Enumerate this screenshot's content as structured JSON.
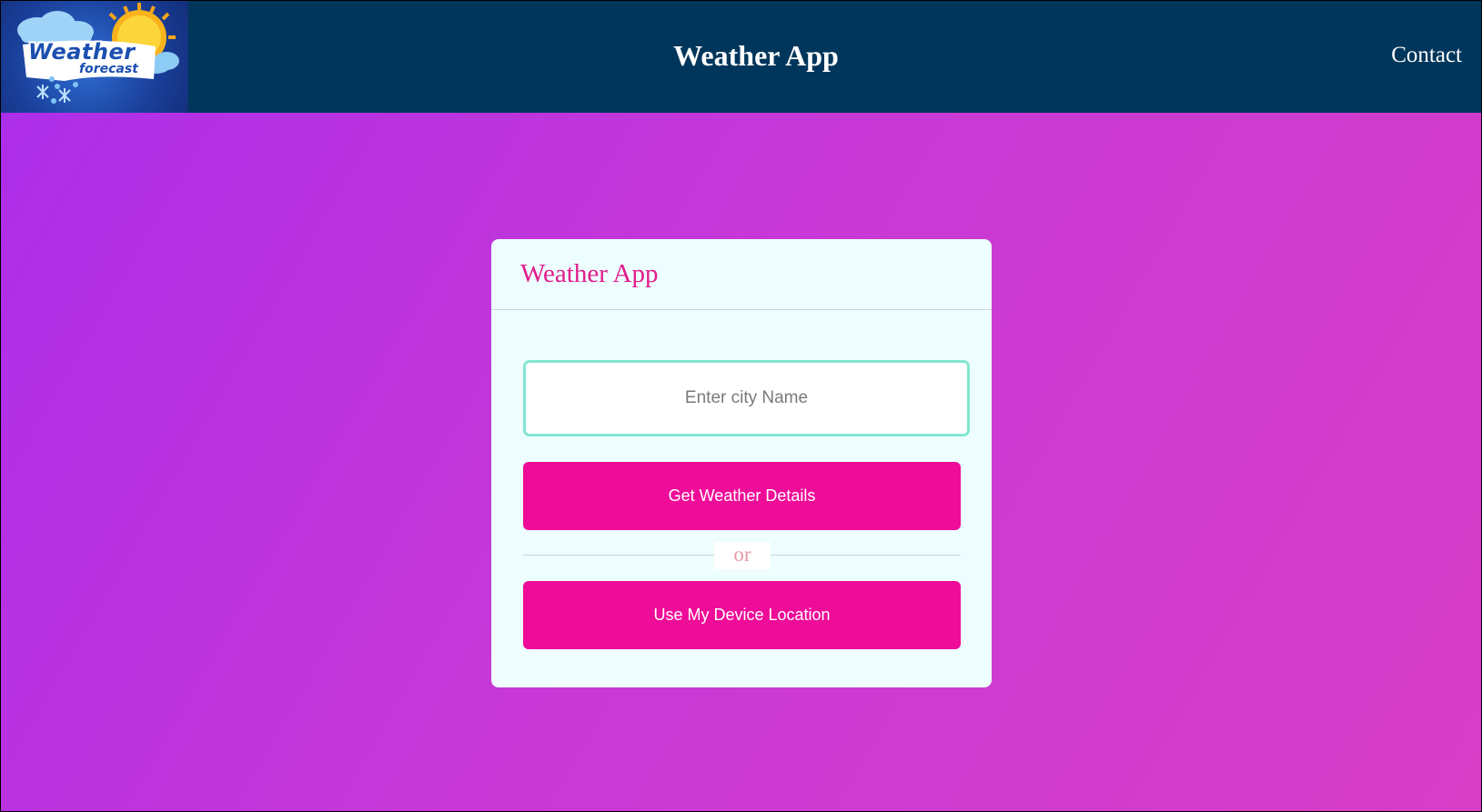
{
  "header": {
    "logo": {
      "word": "Weather",
      "sub": "forecast",
      "icons": [
        "cloud-icon",
        "sun-icon",
        "snowflake-icon",
        "raindrop-icon"
      ]
    },
    "title": "Weather App",
    "contact_label": "Contact"
  },
  "card": {
    "title": "Weather App",
    "search": {
      "placeholder": "Enter city Name",
      "value": ""
    },
    "get_button_label": "Get Weather Details",
    "or_label": "or",
    "location_button_label": "Use My Device Location"
  },
  "colors": {
    "header_bg": "#00365b",
    "accent": "#ef0c98",
    "card_bg": "#eefeff",
    "input_border": "#82e6d0",
    "background_gradient": [
      "#ad2ee9",
      "#d83fc7"
    ]
  }
}
